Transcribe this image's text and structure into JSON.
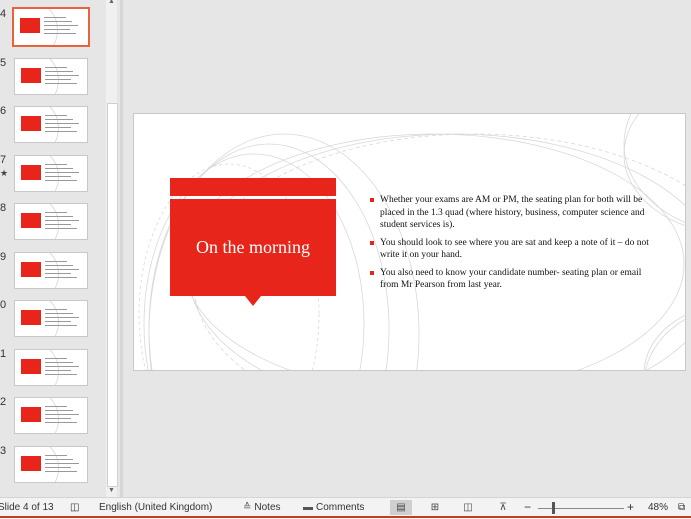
{
  "thumbnails": [
    {
      "num": "4",
      "active": true,
      "star": false
    },
    {
      "num": "5",
      "active": false,
      "star": false
    },
    {
      "num": "6",
      "active": false,
      "star": false
    },
    {
      "num": "7",
      "active": false,
      "star": true
    },
    {
      "num": "8",
      "active": false,
      "star": false
    },
    {
      "num": "9",
      "active": false,
      "star": false
    },
    {
      "num": "0",
      "active": false,
      "star": false
    },
    {
      "num": "1",
      "active": false,
      "star": false
    },
    {
      "num": "2",
      "active": false,
      "star": false
    },
    {
      "num": "3",
      "active": false,
      "star": false
    }
  ],
  "star_glyph": "★",
  "slide": {
    "title": "On the morning",
    "bullets": [
      "Whether your exams are AM or PM, the seating plan for both will be placed in the 1.3 quad (where history, business, computer science and student services is).",
      "You should look to see where you are sat and keep a note of it – do not write it on your hand.",
      "You also need to know your candidate number- seating plan or email from Mr Pearson from last year."
    ],
    "accent_color": "#e8251a"
  },
  "status_bar": {
    "slide_indicator": "Slide 4 of 13",
    "language": "English (United Kingdom)",
    "notes_label": "Notes",
    "comments_label": "Comments",
    "zoom_minus": "−",
    "zoom_plus": "+",
    "zoom_level": "48%"
  }
}
